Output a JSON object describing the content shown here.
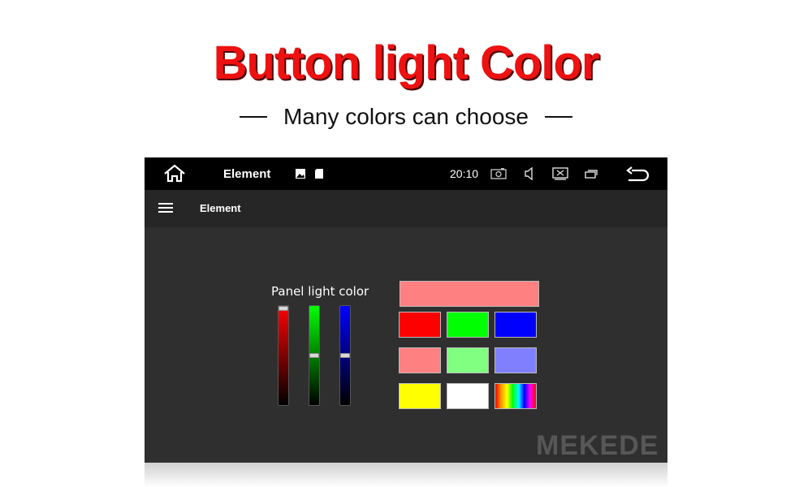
{
  "promo": {
    "title": "Button light Color",
    "subtitle": "Many colors can choose"
  },
  "statusbar": {
    "app_name": "Element",
    "time": "20:10",
    "icons": [
      "home-icon",
      "image-icon",
      "sd-card-icon",
      "camera-icon",
      "volume-icon",
      "screen-off-icon",
      "recent-apps-icon",
      "back-icon"
    ]
  },
  "appbar": {
    "title": "Element",
    "menu_icon": "menu-icon"
  },
  "panel": {
    "label": "Panel light color",
    "sliders": [
      {
        "name": "red",
        "color": "#ff0000",
        "level": 1.0
      },
      {
        "name": "green",
        "color": "#00ff00",
        "level": 0.5
      },
      {
        "name": "blue",
        "color": "#0000ff",
        "level": 0.5
      }
    ],
    "preview_color": "#ff8080",
    "swatches": [
      {
        "color": "#ff0000"
      },
      {
        "color": "#00ff00"
      },
      {
        "color": "#0000ff"
      },
      {
        "color": "#ff8080"
      },
      {
        "color": "#80ff80"
      },
      {
        "color": "#8080ff"
      },
      {
        "color": "#ffff00"
      },
      {
        "color": "#ffffff"
      },
      {
        "color": "rainbow"
      }
    ]
  },
  "watermark": "MEKEDE"
}
